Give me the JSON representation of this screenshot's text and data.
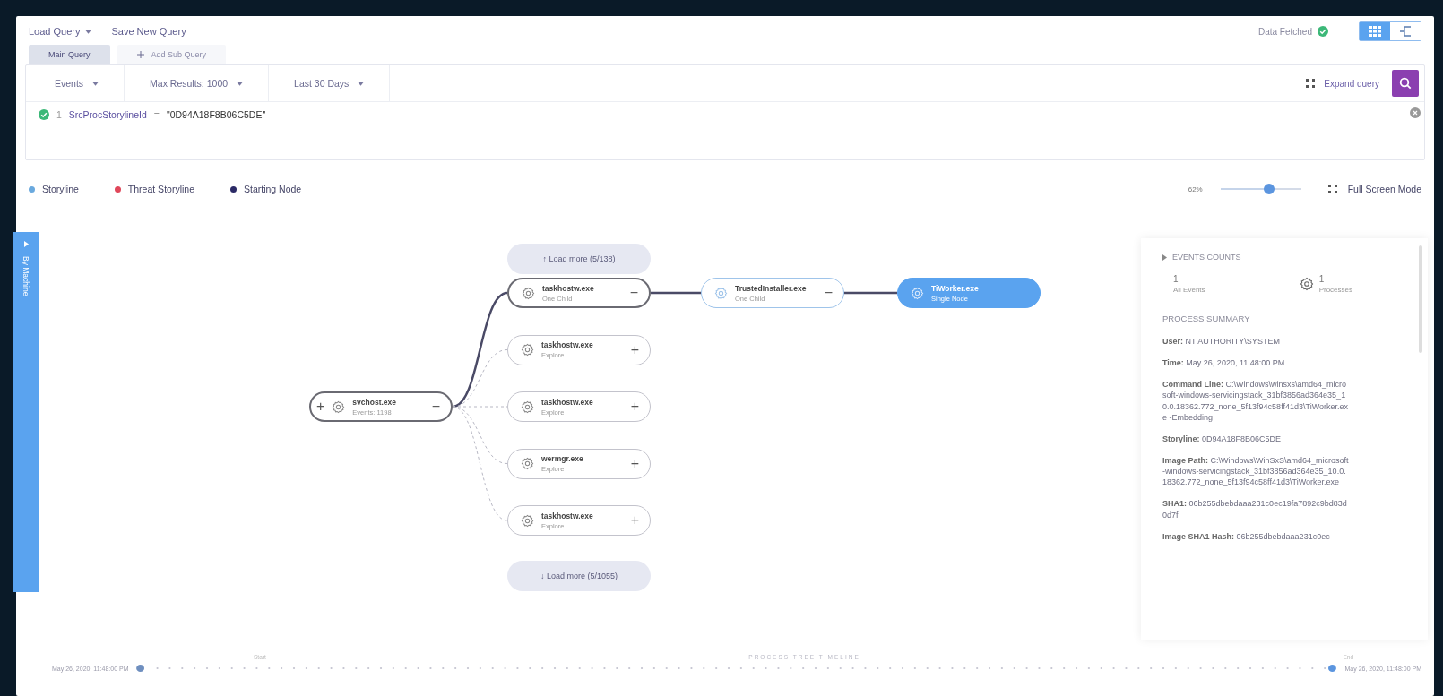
{
  "query_menu": [
    {
      "label": "Load Query",
      "dropdown": true
    },
    {
      "label": "Save New Query",
      "dropdown": false
    }
  ],
  "status": {
    "label": "Data Fetched"
  },
  "view_toggle": [
    {
      "kind": "grid",
      "selected": true
    },
    {
      "kind": "tree",
      "selected": false
    }
  ],
  "query_tabs": [
    {
      "label": "Main Query",
      "kind": "tab",
      "selected": true
    },
    {
      "label": "Add Sub Query",
      "kind": "add",
      "selected": false
    }
  ],
  "filters": [
    {
      "label": "Events"
    },
    {
      "label": "Max Results: 1000"
    },
    {
      "label": "Last 30 Days"
    }
  ],
  "expand_query": "Expand query",
  "query_lines": [
    {
      "number": "1",
      "field": "SrcProcStorylineId",
      "operator": "=",
      "value": "\"0D94A18F8B06C5DE\"",
      "valid": true
    }
  ],
  "legend": [
    {
      "label": "Storyline",
      "color": "#6aa9de"
    },
    {
      "label": "Threat Storyline",
      "color": "#e0475a"
    },
    {
      "label": "Starting Node",
      "color": "#2b2a66"
    }
  ],
  "zoom": {
    "reading": "62%",
    "level": 0.6
  },
  "full_screen": "Full Screen Mode",
  "side_tab": {
    "label": "By Machine"
  },
  "tree": {
    "load_more_top": {
      "arrow": "↑",
      "label": "Load more",
      "count": "(5/138)"
    },
    "load_more_bottom": {
      "arrow": "↓",
      "label": "Load more",
      "count": "(5/1055)"
    },
    "root": {
      "name": "svchost.exe",
      "detail": "Events: 1198",
      "kind": "start",
      "parent_toggle": "+",
      "toggle": "−",
      "children": [
        {
          "name": "taskhostw.exe",
          "detail": "One Child",
          "kind": "start",
          "toggle": "−",
          "on_path": true,
          "children": [
            {
              "name": "TrustedInstaller.exe",
              "detail": "One Child",
              "kind": "storyline",
              "toggle": "−",
              "on_path": true,
              "children": [
                {
                  "name": "TiWorker.exe",
                  "detail": "Single Node",
                  "kind": "selected",
                  "on_path": true
                }
              ]
            }
          ]
        },
        {
          "name": "taskhostw.exe",
          "detail": "Explore",
          "kind": "default",
          "toggle": "+",
          "on_path": false
        },
        {
          "name": "taskhostw.exe",
          "detail": "Explore",
          "kind": "default",
          "toggle": "+",
          "on_path": false
        },
        {
          "name": "wermgr.exe",
          "detail": "Explore",
          "kind": "default",
          "toggle": "+",
          "on_path": false
        },
        {
          "name": "taskhostw.exe",
          "detail": "Explore",
          "kind": "default",
          "toggle": "+",
          "on_path": false
        }
      ]
    }
  },
  "panel": {
    "events_title": "EVENTS COUNTS",
    "counts": [
      {
        "count": "1",
        "label": "All Events",
        "kind": "total"
      },
      {
        "count": "1",
        "label": "Processes",
        "kind": "process"
      }
    ],
    "summary_title": "PROCESS SUMMARY",
    "fields": [
      {
        "label": "User:",
        "value": "NT AUTHORITY\\SYSTEM"
      },
      {
        "label": "Time:",
        "value": "May 26, 2020, 11:48:00 PM"
      },
      {
        "label": "Command Line:",
        "value": "C:\\Windows\\winsxs\\amd64_microsoft-windows-servicingstack_31bf3856ad364e35_10.0.18362.772_none_5f13f94c58ff41d3\\TiWorker.exe -Embedding"
      },
      {
        "label": "Storyline:",
        "value": "0D94A18F8B06C5DE"
      },
      {
        "label": "Image Path:",
        "value": "C:\\Windows\\WinSxS\\amd64_microsoft-windows-servicingstack_31bf3856ad364e35_10.0.18362.772_none_5f13f94c58ff41d3\\TiWorker.exe"
      },
      {
        "label": "SHA1:",
        "value": "06b255dbebdaaa231c0ec19fa7892c9bd83d0d7f"
      },
      {
        "label": "Image SHA1 Hash:",
        "value": "06b255dbebdaaa231c0ec"
      }
    ]
  },
  "timeline": {
    "title": "PROCESS TREE TIMELINE",
    "start_label": "Start",
    "end_label": "End",
    "start_time": "May 26, 2020, 11:48:00 PM",
    "end_time": "May 26, 2020, 11:48:00 PM"
  }
}
